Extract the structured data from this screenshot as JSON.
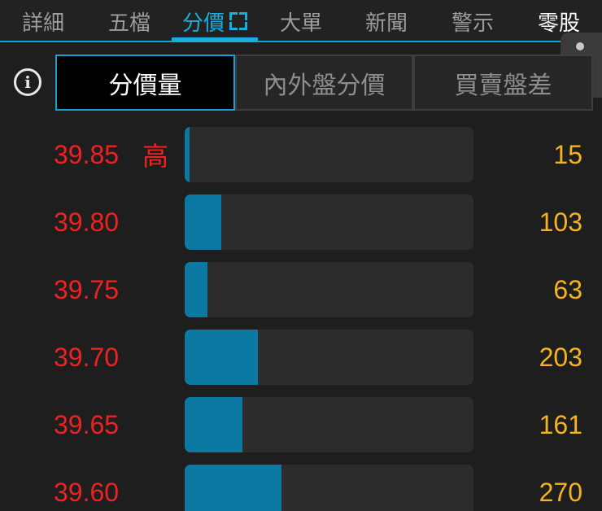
{
  "tabs": [
    {
      "label": "詳細",
      "state": "inactive"
    },
    {
      "label": "五檔",
      "state": "inactive"
    },
    {
      "label": "分價",
      "state": "active"
    },
    {
      "label": "大單",
      "state": "inactive"
    },
    {
      "label": "新聞",
      "state": "inactive"
    },
    {
      "label": "警示",
      "state": "inactive"
    },
    {
      "label": "零股",
      "state": "bright"
    }
  ],
  "segments": [
    {
      "label": "分價量",
      "selected": true
    },
    {
      "label": "內外盤分價",
      "selected": false
    },
    {
      "label": "買賣盤差",
      "selected": false
    }
  ],
  "rows": [
    {
      "price": "39.85",
      "marker": "高",
      "volume": "15",
      "fill_fraction": 0.017
    },
    {
      "price": "39.80",
      "marker": "",
      "volume": "103",
      "fill_fraction": 0.127
    },
    {
      "price": "39.75",
      "marker": "",
      "volume": "63",
      "fill_fraction": 0.079
    },
    {
      "price": "39.70",
      "marker": "",
      "volume": "203",
      "fill_fraction": 0.254
    },
    {
      "price": "39.65",
      "marker": "",
      "volume": "161",
      "fill_fraction": 0.2
    },
    {
      "price": "39.60",
      "marker": "",
      "volume": "270",
      "fill_fraction": 0.335
    }
  ],
  "colors": {
    "accent": "#19aee0",
    "price_up": "#ee2222",
    "volume": "#f5b41f",
    "bar_fill": "#0b79a1",
    "bar_track": "#2c2c2c"
  },
  "icons": {
    "info": "info-icon",
    "expand": "expand-icon",
    "more": "more-vertical-icon"
  }
}
